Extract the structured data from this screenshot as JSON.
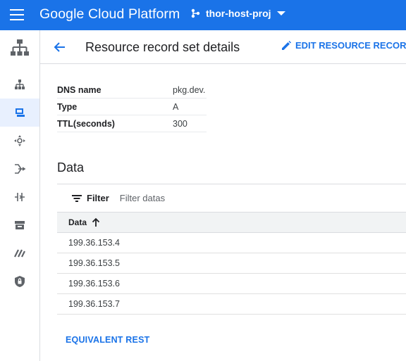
{
  "app": {
    "title": "Google Cloud Platform",
    "project_name": "thor-host-proj",
    "brand_color": "#1a73e8"
  },
  "rail": {
    "items": [
      {
        "icon": "network-topology-icon",
        "active": false
      },
      {
        "icon": "computer-icon",
        "active": true
      },
      {
        "icon": "routes-icon",
        "active": false
      },
      {
        "icon": "load-balancing-icon",
        "active": false
      },
      {
        "icon": "network-services-icon",
        "active": false
      },
      {
        "icon": "storage-icon",
        "active": false
      },
      {
        "icon": "interconnect-icon",
        "active": false
      },
      {
        "icon": "security-icon",
        "active": false
      }
    ]
  },
  "header": {
    "title": "Resource record set details",
    "edit_label": "EDIT RESOURCE RECORD S"
  },
  "properties": [
    {
      "key": "DNS name",
      "value": "pkg.dev."
    },
    {
      "key": "Type",
      "value": "A"
    },
    {
      "key": "TTL(seconds)",
      "value": "300"
    }
  ],
  "data_section": {
    "title": "Data",
    "filter_label": "Filter",
    "filter_placeholder": "Filter datas",
    "column_header": "Data",
    "sort": "ascending",
    "rows": [
      "199.36.153.4",
      "199.36.153.5",
      "199.36.153.6",
      "199.36.153.7"
    ]
  },
  "footer": {
    "rest_label": "EQUIVALENT REST"
  }
}
